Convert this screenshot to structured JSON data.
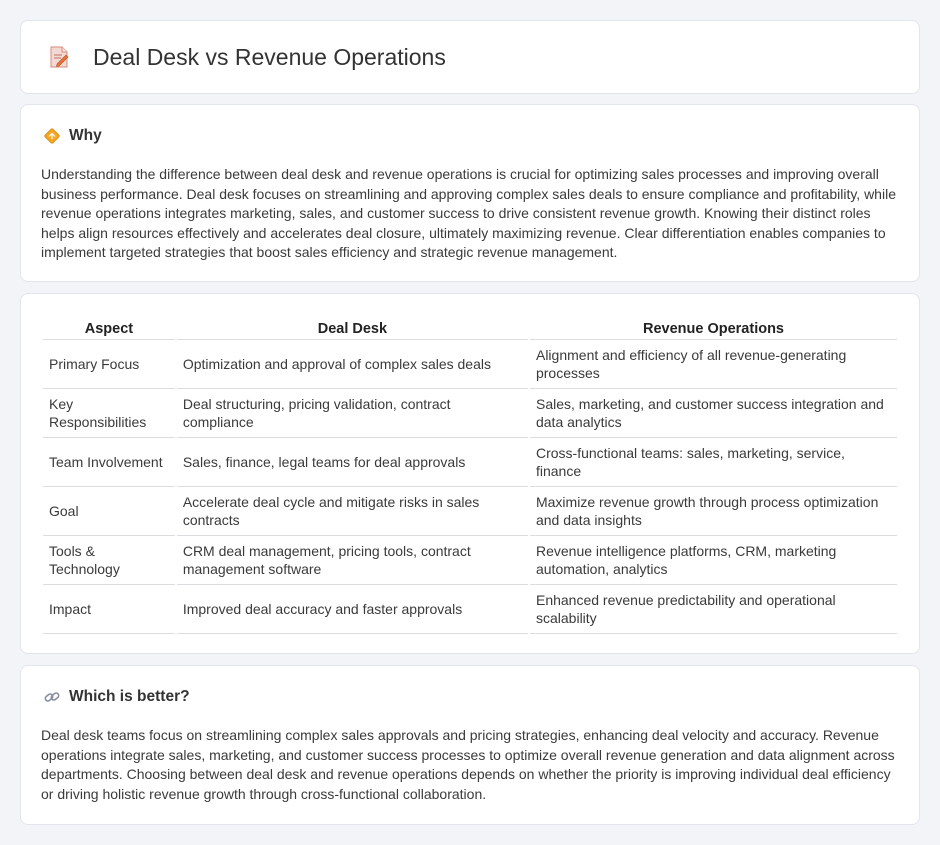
{
  "header": {
    "title": "Deal Desk vs Revenue Operations",
    "icon": "document-pencil-icon"
  },
  "why": {
    "title": "Why",
    "icon": "diamond-sign-icon",
    "text": "Understanding the difference between deal desk and revenue operations is crucial for optimizing sales processes and improving overall business performance. Deal desk focuses on streamlining and approving complex sales deals to ensure compliance and profitability, while revenue operations integrates marketing, sales, and customer success to drive consistent revenue growth. Knowing their distinct roles helps align resources effectively and accelerates deal closure, ultimately maximizing revenue. Clear differentiation enables companies to implement targeted strategies that boost sales efficiency and strategic revenue management."
  },
  "table": {
    "headers": [
      "Aspect",
      "Deal Desk",
      "Revenue Operations"
    ],
    "rows": [
      [
        "Primary Focus",
        "Optimization and approval of complex sales deals",
        "Alignment and efficiency of all revenue-generating processes"
      ],
      [
        "Key Responsibilities",
        "Deal structuring, pricing validation, contract compliance",
        "Sales, marketing, and customer success integration and data analytics"
      ],
      [
        "Team Involvement",
        "Sales, finance, legal teams for deal approvals",
        "Cross-functional teams: sales, marketing, service, finance"
      ],
      [
        "Goal",
        "Accelerate deal cycle and mitigate risks in sales contracts",
        "Maximize revenue growth through process optimization and data insights"
      ],
      [
        "Tools & Technology",
        "CRM deal management, pricing tools, contract management software",
        "Revenue intelligence platforms, CRM, marketing automation, analytics"
      ],
      [
        "Impact",
        "Improved deal accuracy and faster approvals",
        "Enhanced revenue predictability and operational scalability"
      ]
    ]
  },
  "better": {
    "title": "Which is better?",
    "icon": "link-icon",
    "text": "Deal desk teams focus on streamlining complex sales approvals and pricing strategies, enhancing deal velocity and accuracy. Revenue operations integrate sales, marketing, and customer success processes to optimize overall revenue generation and data alignment across departments. Choosing between deal desk and revenue operations depends on whether the priority is improving individual deal efficiency or driving holistic revenue growth through cross-functional collaboration."
  }
}
